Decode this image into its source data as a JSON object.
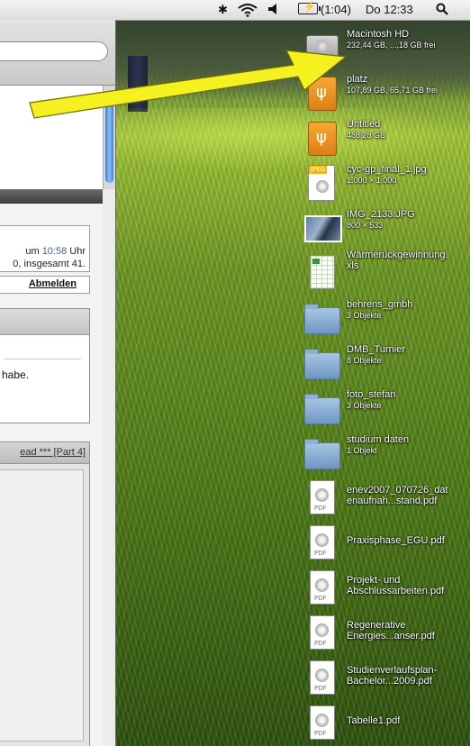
{
  "menubar": {
    "bluetooth_glyph": "✱",
    "wifi_glyph": "📶",
    "volume_glyph": "◀",
    "battery_text": "(1:04)",
    "clock": "Do 12:33",
    "search_glyph": "⌕"
  },
  "browser": {
    "info_line1_prefix": "um ",
    "info_time": "10:58",
    "info_line1_suffix": " Uhr",
    "info_line2": "0, insgesamt 41.",
    "logout_label": "Abmelden",
    "panel_text": "habe.",
    "thread_link": "ead *** [Part 4]"
  },
  "desktop": {
    "items": [
      {
        "name": "Macintosh HD",
        "info": "232,44 GB, ...,18 GB frei",
        "kind": "hd-icon"
      },
      {
        "name": "platz",
        "info": "107,89 GB, 65,71 GB frei",
        "kind": "external-drive-icon"
      },
      {
        "name": "Untitled",
        "info": "488,28 GB",
        "kind": "external-drive-icon"
      },
      {
        "name": "cyc-gp_final_1.jpg",
        "info": "1.000 × 1.000",
        "kind": "jpeg-icon",
        "badge": "JPEG"
      },
      {
        "name": "IMG_2133.JPG",
        "info": "800 × 533",
        "kind": "photo-icon"
      },
      {
        "name": "Wärmerückgewinnung.",
        "name2": "xls",
        "kind": "xls-icon"
      },
      {
        "name": "behrens_gmbh",
        "info": "3 Objekte",
        "kind": "folder-icon"
      },
      {
        "name": "DMB_Turnier",
        "info": "8 Objekte",
        "kind": "folder-icon"
      },
      {
        "name": "foto_stefan",
        "info": "3 Objekte",
        "kind": "folder-icon"
      },
      {
        "name": "studium daten",
        "info": "1 Objekt",
        "kind": "folder-icon"
      },
      {
        "name": "enev2007_070726_dat",
        "name2": "enaufnah...stand.pdf",
        "kind": "pdf-icon"
      },
      {
        "name": "Praxisphase_EGU.pdf",
        "kind": "pdf-icon"
      },
      {
        "name": "Projekt- und",
        "name2": "Abschlussarbeiten.pdf",
        "kind": "pdf-icon"
      },
      {
        "name": "Regenerative",
        "name2": "Energies...anser.pdf",
        "kind": "pdf-icon"
      },
      {
        "name": "Studienverlaufsplan-",
        "name2": "Bachelor...2009.pdf",
        "kind": "pdf-icon"
      },
      {
        "name": "Tabelle1.pdf",
        "kind": "pdf-icon"
      }
    ],
    "pdf_tag": "PDF"
  },
  "annotation": {
    "arrow_color": "#f5f020"
  }
}
